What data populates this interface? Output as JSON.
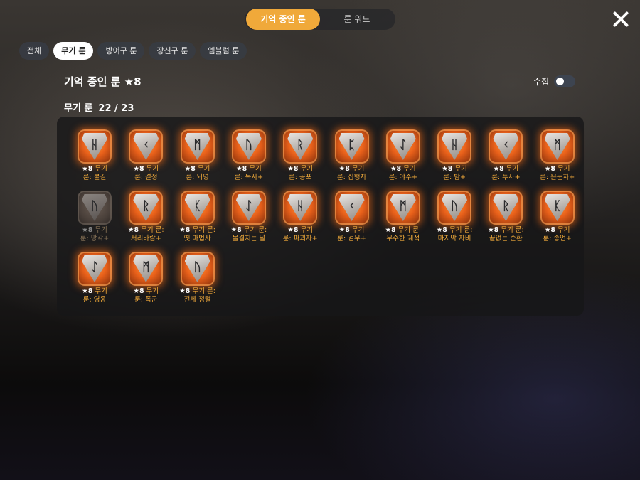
{
  "tabs": {
    "active_label": "기억 중인 룬",
    "inactive_label": "룬 워드"
  },
  "filters": [
    "전체",
    "무기 룬",
    "방어구 룬",
    "장신구 룬",
    "엠블럼 룬"
  ],
  "active_filter": "무기 룬",
  "header": {
    "title": "기억 중인 룬 ★8",
    "collect_label": "수집",
    "collect_toggle_on": false,
    "category_label": "무기 룬",
    "count": "22 / 23"
  },
  "runes": [
    {
      "glyph": "ᚺ",
      "star": "★8",
      "line1": "무기",
      "line2": "룬: 불길",
      "dim": false
    },
    {
      "glyph": "ᚲ",
      "star": "★8",
      "line1": "무기",
      "line2": "룬: 결정",
      "dim": false
    },
    {
      "glyph": "ᛗ",
      "star": "★8",
      "line1": "무기",
      "line2": "룬: 뇌명",
      "dim": false
    },
    {
      "glyph": "ᚢ",
      "star": "★8",
      "line1": "무기",
      "line2": "룬: 독사+",
      "dim": false
    },
    {
      "glyph": "ᚱ",
      "star": "★8",
      "line1": "무기",
      "line2": "룬: 공포",
      "dim": false
    },
    {
      "glyph": "ᛈ",
      "star": "★8",
      "line1": "무기",
      "line2": "룬: 집행자",
      "dim": false
    },
    {
      "glyph": "ᛇ",
      "star": "★8",
      "line1": "무기",
      "line2": "룬: 야수+",
      "dim": false
    },
    {
      "glyph": "ᚺ",
      "star": "★8",
      "line1": "무기",
      "line2": "룬: 밤+",
      "dim": false
    },
    {
      "glyph": "ᚲ",
      "star": "★8",
      "line1": "무기",
      "line2": "룬: 투사+",
      "dim": false
    },
    {
      "glyph": "ᛗ",
      "star": "★8",
      "line1": "무기",
      "line2": "룬: 은둔자+",
      "dim": false
    },
    {
      "glyph": "ᚢ",
      "star": "★8",
      "line1": "무기",
      "line2": "룬: 망각+",
      "dim": true
    },
    {
      "glyph": "ᚱ",
      "star": "★8",
      "line1": "무기 룬:",
      "line2": "서리바람+",
      "dim": false
    },
    {
      "glyph": "ᛕ",
      "star": "★8",
      "line1": "무기 룬:",
      "line2": "옛 마법사",
      "dim": false
    },
    {
      "glyph": "ᛇ",
      "star": "★8",
      "line1": "무기 룬:",
      "line2": "몰결치는 날",
      "dim": false
    },
    {
      "glyph": "ᚺ",
      "star": "★8",
      "line1": "무기",
      "line2": "룬: 파괴자+",
      "dim": false
    },
    {
      "glyph": "ᚲ",
      "star": "★8",
      "line1": "무기",
      "line2": "룬: 검무+",
      "dim": false
    },
    {
      "glyph": "ᛗ",
      "star": "★8",
      "line1": "무기 룬:",
      "line2": "무수한 궤적",
      "dim": false
    },
    {
      "glyph": "ᚢ",
      "star": "★8",
      "line1": "무기 룬:",
      "line2": "마지막 자비",
      "dim": false
    },
    {
      "glyph": "ᚱ",
      "star": "★8",
      "line1": "무기 룬:",
      "line2": "끝없는 순환",
      "dim": false
    },
    {
      "glyph": "ᛕ",
      "star": "★8",
      "line1": "무기",
      "line2": "룬: 종언+",
      "dim": false
    },
    {
      "glyph": "ᛇ",
      "star": "★8",
      "line1": "무기",
      "line2": "룬: 영웅",
      "dim": false
    },
    {
      "glyph": "ᛗ",
      "star": "★8",
      "line1": "무기",
      "line2": "룬: 폭군",
      "dim": false
    },
    {
      "glyph": "ᚢ",
      "star": "★8",
      "line1": "무기 룬:",
      "line2": "전체 정렬",
      "dim": false
    }
  ]
}
